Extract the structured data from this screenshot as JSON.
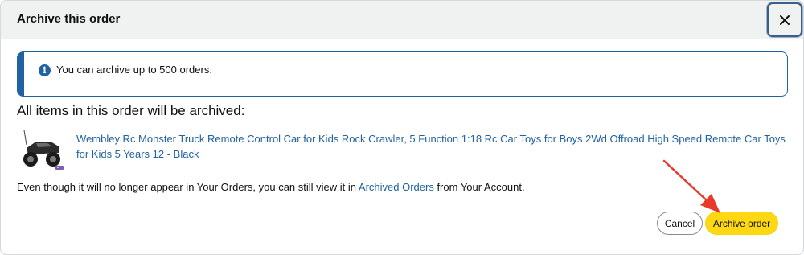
{
  "dialog": {
    "title": "Archive this order",
    "close_label": "✕"
  },
  "info": {
    "icon": "info-icon",
    "icon_glyph": "i",
    "text": "You can archive up to 500 orders."
  },
  "items_heading": "All items in this order will be archived:",
  "product": {
    "title": "Wembley Rc Monster Truck Remote Control Car for Kids Rock Crawler, 5 Function 1:18 Rc Car Toys for Boys 2Wd Offroad High Speed Remote Car Toys for Kids 5 Years 12 - Black",
    "thumbnail_icon": "rc-truck-thumbnail"
  },
  "note": {
    "prefix": "Even though it will no longer appear in Your Orders, you can still view it in ",
    "link": "Archived Orders",
    "suffix": " from Your Account."
  },
  "buttons": {
    "cancel": "Cancel",
    "archive": "Archive order"
  },
  "colors": {
    "link": "#2162a1",
    "primary_button": "#ffd814",
    "header_bg": "#f0f2f2",
    "annotation_arrow": "#e8392a"
  }
}
